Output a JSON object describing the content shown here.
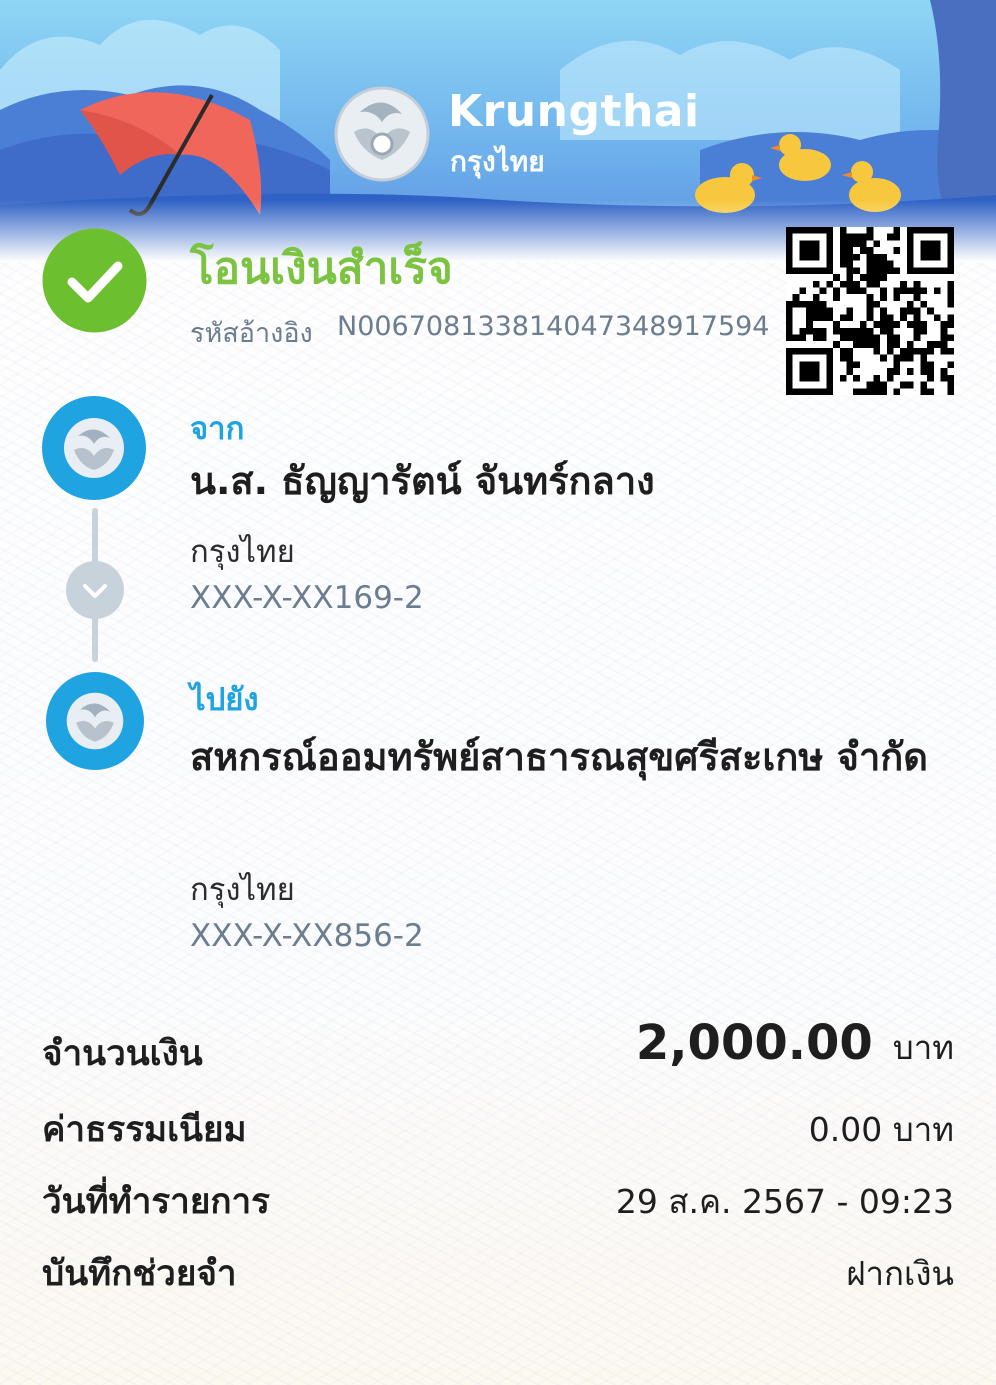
{
  "brand": {
    "name_en": "Krungthai",
    "name_th": "กรุงไทย",
    "primary_color": "#1fa3e1",
    "success_color": "#7cc342"
  },
  "status": {
    "title": "โอนเงินสำเร็จ",
    "ref_label": "รหัสอ้างอิง",
    "ref_value": "N006708133814047348917594",
    "icon": "checkmark-icon",
    "qr_icon": "qr-code-icon"
  },
  "from": {
    "label": "จาก",
    "name": "น.ส. ธัญญารัตน์ จันทร์กลาง",
    "bank": "กรุงไทย",
    "account": "XXX-X-XX169-2",
    "icon": "krungthai-bank-icon"
  },
  "to": {
    "label": "ไปยัง",
    "name": "สหกรณ์ออมทรัพย์สาธารณสุขศรีสะเกษ จำกัด",
    "bank": "กรุงไทย",
    "account": "XXX-X-XX856-2",
    "icon": "krungthai-bank-icon"
  },
  "details": {
    "amount_label": "จำนวนเงิน",
    "amount_value": "2,000.00",
    "amount_currency": "บาท",
    "fee_label": "ค่าธรรมเนียม",
    "fee_value": "0.00 บาท",
    "date_label": "วันที่ทำรายการ",
    "date_value": "29 ส.ค. 2567 - 09:23",
    "memo_label": "บันทึกช่วยจำ",
    "memo_value": "ฝากเงิน"
  }
}
